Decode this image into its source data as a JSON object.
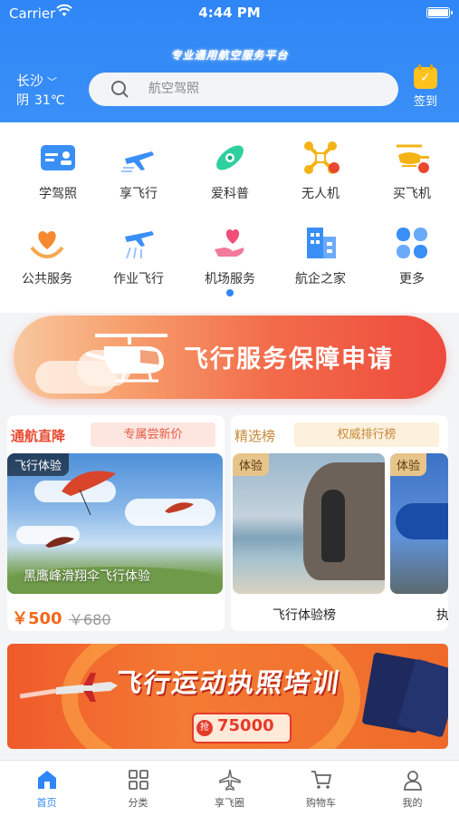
{
  "status_bar": {
    "carrier": "Carrier",
    "time": "4:44 PM"
  },
  "header": {
    "slogan": "专业通用航空服务平台",
    "city": "长沙",
    "weather": {
      "condition": "阴",
      "temperature": "31℃"
    },
    "search": {
      "placeholder": "航空驾照"
    },
    "checkin_label": "签到"
  },
  "grid": {
    "items": [
      {
        "label": "学驾照",
        "icon": "license-card-icon"
      },
      {
        "label": "享飞行",
        "icon": "airplane-icon"
      },
      {
        "label": "爱科普",
        "icon": "science-icon"
      },
      {
        "label": "无人机",
        "icon": "drone-icon"
      },
      {
        "label": "买飞机",
        "icon": "helicopter-sale-icon"
      },
      {
        "label": "公共服务",
        "icon": "heart-hands-icon"
      },
      {
        "label": "作业飞行",
        "icon": "crop-duster-icon"
      },
      {
        "label": "机场服务",
        "icon": "heart-hand-icon"
      },
      {
        "label": "航企之家",
        "icon": "building-icon"
      },
      {
        "label": "更多",
        "icon": "more-grid-icon"
      }
    ]
  },
  "banner": {
    "title": "飞行服务保障申请"
  },
  "promo_left": {
    "title": "通航直降",
    "tag": "专属尝新价",
    "photo_label": "飞行体验",
    "caption": "黑鹰峰滑翔伞飞行体验",
    "price": "￥500",
    "old_price": "￥680"
  },
  "promo_right": {
    "title": "精选榜",
    "tag": "权威排行榜",
    "items": [
      {
        "tag": "体验",
        "caption": "飞行体验榜"
      },
      {
        "tag": "体验",
        "caption": "执"
      }
    ]
  },
  "banner2": {
    "title": "飞行运动执照培训",
    "coupon_tag": "抢",
    "coupon_amount": "75000"
  },
  "tabbar": {
    "items": [
      {
        "label": "首页",
        "icon": "home-icon",
        "active": true
      },
      {
        "label": "分类",
        "icon": "category-grid-icon",
        "active": false
      },
      {
        "label": "享飞圈",
        "icon": "airplane-circle-icon",
        "active": false
      },
      {
        "label": "购物车",
        "icon": "cart-icon",
        "active": false
      },
      {
        "label": "我的",
        "icon": "profile-icon",
        "active": false
      }
    ]
  },
  "colors": {
    "primary": "#2f86f6",
    "accent": "#e8482f",
    "price": "#f06a1a",
    "gold": "#c7893a"
  }
}
